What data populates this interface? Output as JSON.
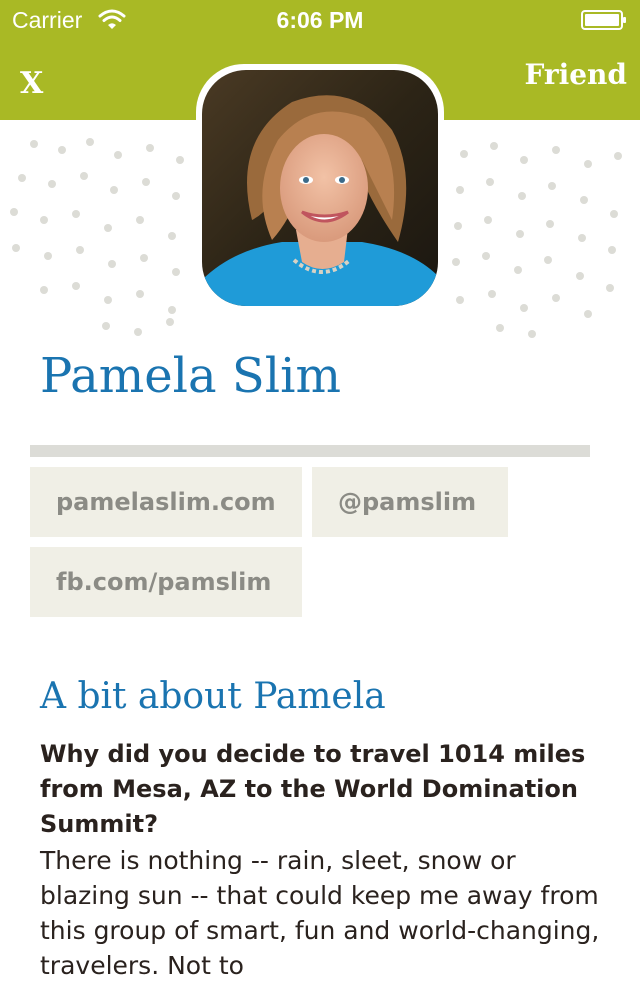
{
  "status_bar": {
    "carrier": "Carrier",
    "time": "6:06 PM",
    "icons": [
      "wifi-icon",
      "battery-icon"
    ]
  },
  "nav": {
    "close_label": "X",
    "friend_label": "Friend"
  },
  "colors": {
    "header_bg": "#a9b925",
    "name_blue": "#1a74b0",
    "chip_bg": "#f0efe6",
    "chip_text": "#8b8b85",
    "body_text": "#2a221e",
    "divider": "#dcdcd7"
  },
  "profile": {
    "name": "Pamela Slim",
    "avatar_alt": "profile-photo"
  },
  "links": {
    "website": "pamelaslim.com",
    "twitter": "@pamslim",
    "facebook": "fb.com/pamslim"
  },
  "about": {
    "title": "A bit about Pamela",
    "question": "Why did you decide to travel 1014 miles from Mesa, AZ to the World Domination Summit?",
    "answer": "There is nothing -- rain, sleet, snow or blazing sun -- that could keep me away from this group of smart, fun and world-changing, travelers. Not to"
  }
}
